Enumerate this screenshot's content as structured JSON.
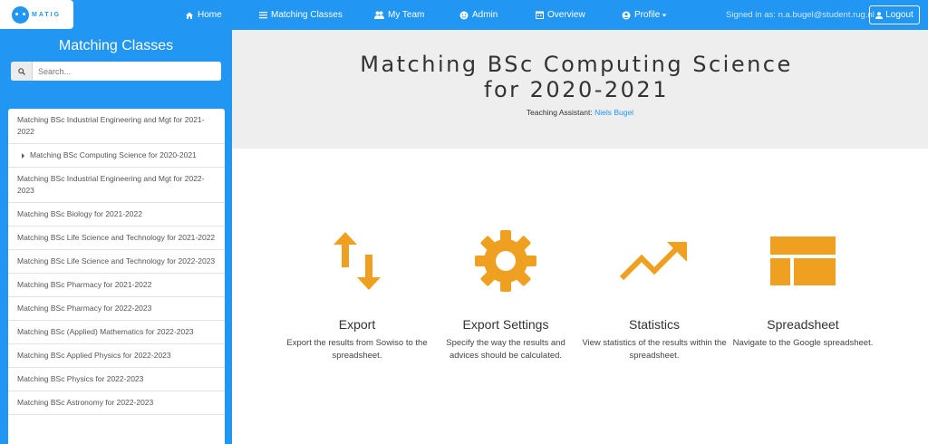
{
  "app": {
    "logo_text": "MATIG"
  },
  "nav": {
    "home": "Home",
    "matching_classes": "Matching Classes",
    "my_team": "My Team",
    "admin": "Admin",
    "overview": "Overview",
    "profile": "Profile"
  },
  "user": {
    "signed_in": "Signed in as: n.a.bugel@student.rug.nl",
    "logout": "Logout"
  },
  "sidebar": {
    "title": "Matching Classes",
    "search_placeholder": "Search...",
    "items": [
      "Matching BSc Industrial Engineering and Mgt for 2021-2022",
      "Matching BSc Computing Science for 2020-2021",
      "Matching BSc Industrial Engineering and Mgt for 2022-2023",
      "Matching BSc Biology for 2021-2022",
      "Matching BSc Life Science and Technology for 2021-2022",
      "Matching BSc Life Science and Technology for 2022-2023",
      "Matching BSc Pharmacy for 2021-2022",
      "Matching BSc Pharmacy for 2022-2023",
      "Matching BSc (Applied) Mathematics for 2022-2023",
      "Matching BSc Applied Physics for 2022-2023",
      "Matching BSc Physics for 2022-2023",
      "Matching BSc Astronomy for 2022-2023"
    ],
    "active_index": 1
  },
  "main": {
    "title": "Matching BSc Computing Science for 2020-2021",
    "ta_label": "Teaching Assistant:",
    "ta_name": "Niels Bugel",
    "cards": [
      {
        "title": "Export",
        "desc": "Export the results from Sowiso to the spreadsheet.",
        "icon": "swap-vertical-icon"
      },
      {
        "title": "Export Settings",
        "desc": "Specify the way the results and advices should be calculated.",
        "icon": "gear-icon"
      },
      {
        "title": "Statistics",
        "desc": "View statistics of the results within the spreadsheet.",
        "icon": "trending-up-icon"
      },
      {
        "title": "Spreadsheet",
        "desc": "Navigate to the Google spreadsheet.",
        "icon": "spreadsheet-icon"
      }
    ]
  },
  "colors": {
    "brand": "#2196f3",
    "accent": "#f0a020",
    "hero_bg": "#eeeeee"
  }
}
